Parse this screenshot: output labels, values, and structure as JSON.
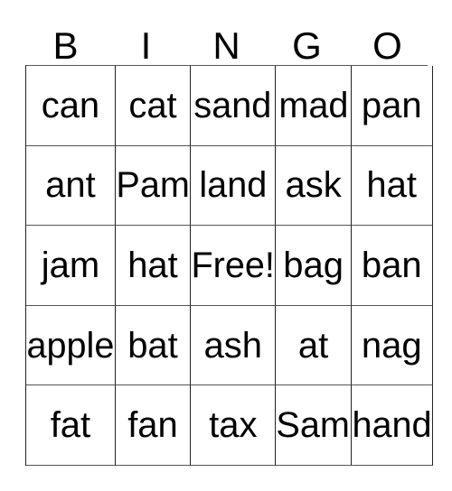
{
  "card": {
    "title": "BINGO",
    "header_letters": [
      "B",
      "I",
      "N",
      "G",
      "O"
    ],
    "free_space_label": "Free!",
    "colors": {
      "text": "#000000",
      "background": "#ffffff",
      "grid_line": "#222222"
    },
    "grid_size": "5x5",
    "rows": [
      {
        "cells": [
          "can",
          "cat",
          "sand",
          "mad",
          "pan"
        ]
      },
      {
        "cells": [
          "ant",
          "Pam",
          "land",
          "ask",
          "hat"
        ]
      },
      {
        "cells": [
          "jam",
          "hat",
          "Free!",
          "bag",
          "ban"
        ]
      },
      {
        "cells": [
          "apple",
          "bat",
          "ash",
          "at",
          "nag"
        ]
      },
      {
        "cells": [
          "fat",
          "fan",
          "tax",
          "Sam",
          "hand"
        ]
      }
    ]
  }
}
